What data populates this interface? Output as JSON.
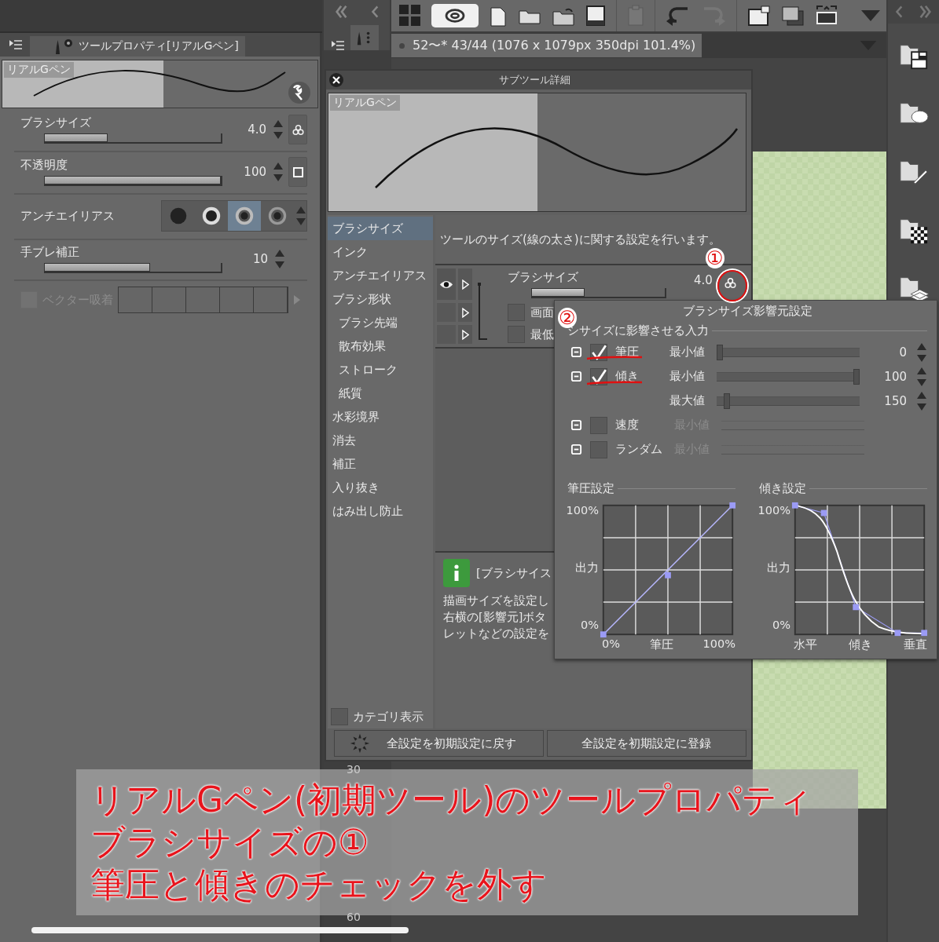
{
  "tool_property": {
    "title": "ツールプロパティ[リアルGペン]",
    "preview_label": "リアルGペン",
    "sliders": [
      {
        "label": "ブラシサイズ",
        "value": "4.0",
        "level": 0.36
      },
      {
        "label": "不透明度",
        "value": "100",
        "level": 1
      },
      {
        "label": "手ブレ補正",
        "value": "10",
        "level": 0.6
      }
    ],
    "antialias": {
      "label": "アンチエイリアス",
      "options": [
        {
          "selected": false
        },
        {
          "selected": false
        },
        {
          "selected": true
        },
        {
          "selected": false
        }
      ]
    },
    "vector_snap": {
      "label": "ベクター吸着",
      "checked": false
    }
  },
  "size_strip": [
    "30",
    "60"
  ],
  "document_tab": "52〜* 43/44 (1076 x 1079px 350dpi 101.4%)",
  "subtool_dialog": {
    "title": "サブツール詳細",
    "preview_label": "リアルGペン",
    "categories": [
      {
        "label": "ブラシサイズ",
        "selected": true
      },
      {
        "label": "インク",
        "selected": false
      },
      {
        "label": "アンチエイリアス",
        "selected": false
      },
      {
        "label": "ブラシ形状",
        "selected": false,
        "children": [
          {
            "label": "ブラシ先端",
            "selected": false
          },
          {
            "label": "散布効果",
            "selected": false
          },
          {
            "label": "ストローク",
            "selected": false
          },
          {
            "label": "紙質",
            "selected": false
          }
        ]
      },
      {
        "label": "水彩境界",
        "selected": false
      },
      {
        "label": "消去",
        "selected": false
      },
      {
        "label": "補正",
        "selected": false
      },
      {
        "label": "入り抜き",
        "selected": false
      },
      {
        "label": "はみ出し防止",
        "selected": false
      }
    ],
    "description": "ツールのサイズ(線の太さ)に関する設定を行います。",
    "setting": {
      "label": "ブラシサイズ",
      "value": "4.0",
      "level": 0.4
    },
    "sub_settings": [
      {
        "label": "画面",
        "checked": false
      },
      {
        "label": "最低",
        "checked": false
      }
    ],
    "help_title": "[ブラシサイス",
    "help_lines": [
      "描画サイズを設定し",
      "右横の[影響元]ボタ",
      "レットなどの設定を"
    ],
    "category_display": {
      "label": "カテゴリ表示",
      "checked": false
    },
    "buttons": [
      "全設定を初期設定に戻す",
      "全設定を初期設定に登録"
    ]
  },
  "influence_popup": {
    "title": "ブラシサイズ影響元設定",
    "section": "シサイズに影響させる入力",
    "inputs": [
      {
        "label": "筆圧",
        "checked": true,
        "params": [
          {
            "label": "最小値",
            "value": "0",
            "level": 0
          }
        ]
      },
      {
        "label": "傾き",
        "checked": true,
        "params": [
          {
            "label": "最小値",
            "value": "100",
            "level": 1
          },
          {
            "label": "最大値",
            "value": "150",
            "level": 0.05
          }
        ]
      },
      {
        "label": "速度",
        "checked": false,
        "params": [
          {
            "label": "最小値"
          }
        ]
      },
      {
        "label": "ランダム",
        "checked": false,
        "params": [
          {
            "label": "最小値"
          }
        ]
      }
    ],
    "graphs": [
      {
        "kind": "linear",
        "title": "筆圧設定",
        "y_labels": [
          "100%",
          "出力",
          "0%"
        ],
        "x_labels": [
          "0%",
          "筆圧",
          "100%"
        ]
      },
      {
        "kind": "s_curve",
        "title": "傾き設定",
        "y_labels": [
          "100%",
          "出力",
          "0%"
        ],
        "x_labels": [
          "水平",
          "傾き",
          "垂直"
        ]
      }
    ]
  },
  "annotation": {
    "markers": [
      "①",
      "②"
    ],
    "caption": [
      "リアルGペン(初期ツール)のツールプロパティ",
      "ブラシサイズの①",
      "筆圧と傾きのチェックを外す"
    ]
  }
}
